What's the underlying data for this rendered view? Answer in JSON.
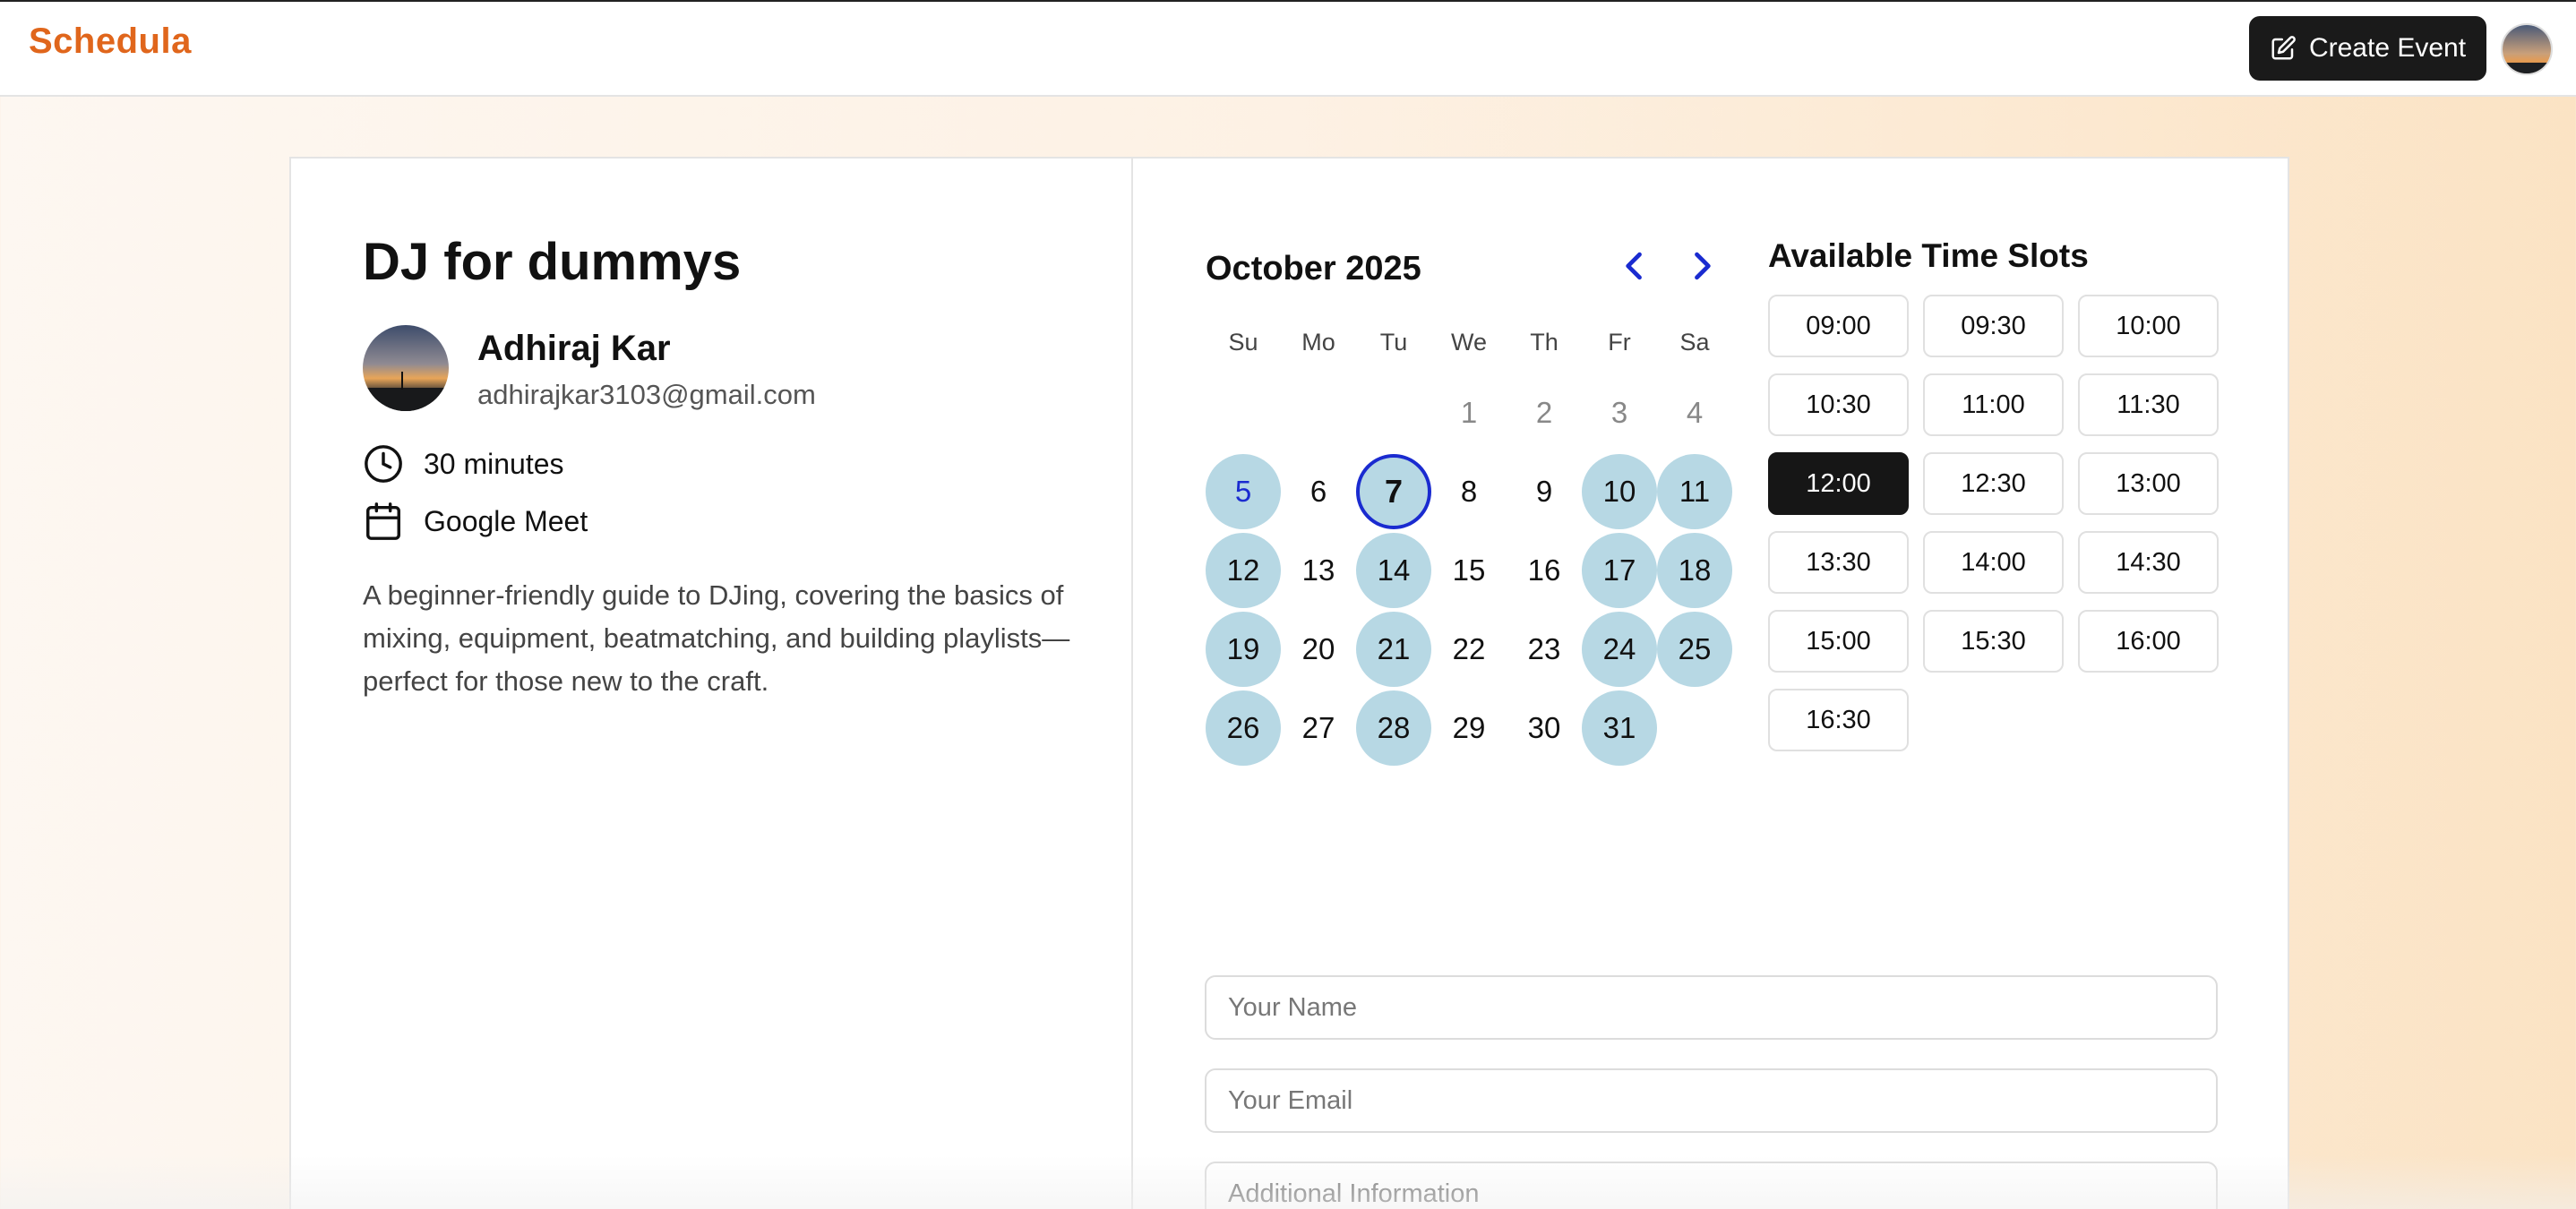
{
  "header": {
    "logo": "Schedula",
    "create_button": "Create Event"
  },
  "event": {
    "title": "DJ for dummys",
    "host_name": "Adhiraj Kar",
    "host_email": "adhirajkar3103@gmail.com",
    "duration": "30 minutes",
    "location": "Google Meet",
    "description": "A beginner-friendly guide to DJing, covering the basics of mixing, equipment, beatmatching, and building playlists—perfect for those new to the craft."
  },
  "calendar": {
    "month_label": "October 2025",
    "weekdays": [
      "Su",
      "Mo",
      "Tu",
      "We",
      "Th",
      "Fr",
      "Sa"
    ],
    "days": [
      {
        "label": "1",
        "state": "muted"
      },
      {
        "label": "2",
        "state": "muted"
      },
      {
        "label": "3",
        "state": "muted"
      },
      {
        "label": "4",
        "state": "muted"
      },
      {
        "label": "5",
        "state": "selected"
      },
      {
        "label": "6",
        "state": "plain"
      },
      {
        "label": "7",
        "state": "today"
      },
      {
        "label": "8",
        "state": "plain"
      },
      {
        "label": "9",
        "state": "plain"
      },
      {
        "label": "10",
        "state": "available"
      },
      {
        "label": "11",
        "state": "available"
      },
      {
        "label": "12",
        "state": "available"
      },
      {
        "label": "13",
        "state": "plain"
      },
      {
        "label": "14",
        "state": "available"
      },
      {
        "label": "15",
        "state": "plain"
      },
      {
        "label": "16",
        "state": "plain"
      },
      {
        "label": "17",
        "state": "available"
      },
      {
        "label": "18",
        "state": "available"
      },
      {
        "label": "19",
        "state": "available"
      },
      {
        "label": "20",
        "state": "plain"
      },
      {
        "label": "21",
        "state": "available"
      },
      {
        "label": "22",
        "state": "plain"
      },
      {
        "label": "23",
        "state": "plain"
      },
      {
        "label": "24",
        "state": "available"
      },
      {
        "label": "25",
        "state": "available"
      },
      {
        "label": "26",
        "state": "available"
      },
      {
        "label": "27",
        "state": "plain"
      },
      {
        "label": "28",
        "state": "available"
      },
      {
        "label": "29",
        "state": "plain"
      },
      {
        "label": "30",
        "state": "plain"
      },
      {
        "label": "31",
        "state": "available"
      }
    ]
  },
  "time_slots": {
    "title": "Available Time Slots",
    "selected": "12:00",
    "slots": [
      "09:00",
      "09:30",
      "10:00",
      "10:30",
      "11:00",
      "11:30",
      "12:00",
      "12:30",
      "13:00",
      "13:30",
      "14:00",
      "14:30",
      "15:00",
      "15:30",
      "16:00",
      "16:30"
    ]
  },
  "form": {
    "name_placeholder": "Your Name",
    "email_placeholder": "Your Email",
    "info_placeholder": "Additional Information"
  },
  "colors": {
    "brand": "#e0661c",
    "available_day": "#b7d8e4",
    "today_ring": "#1a2bd0",
    "nav_arrow": "#1a2bd0",
    "active_slot": "#161616"
  }
}
